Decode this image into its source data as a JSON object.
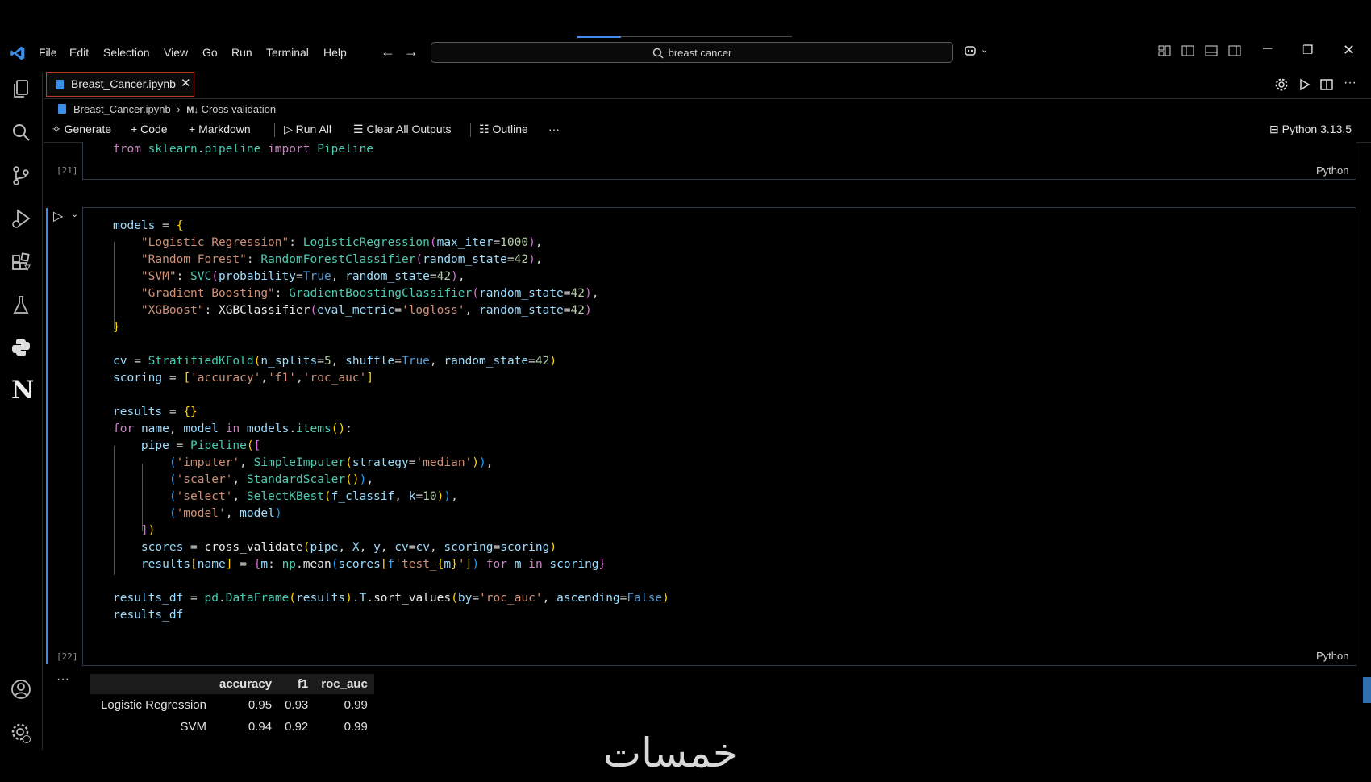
{
  "menu": [
    "File",
    "Edit",
    "Selection",
    "View",
    "Go",
    "Run",
    "Terminal",
    "Help"
  ],
  "search": {
    "text": "breast cancer"
  },
  "tab": {
    "label": "Breast_Cancer.ipynb"
  },
  "breadcrumb": {
    "file": "Breast_Cancer.ipynb",
    "section_prefix": "M↓",
    "section": "Cross validation"
  },
  "toolbar": {
    "generate": "Generate",
    "code": "Code",
    "markdown": "Markdown",
    "run_all": "Run All",
    "clear_outputs": "Clear All Outputs",
    "outline": "Outline",
    "more": "···",
    "kernel": "Python 3.13.5"
  },
  "cell21": {
    "exec_count": "[21]",
    "language": "Python"
  },
  "cell22": {
    "exec_count": "[22]",
    "language": "Python"
  },
  "output": {
    "ellipsis": "···",
    "columns": [
      "accuracy",
      "f1",
      "roc_auc"
    ],
    "rows": [
      {
        "index": "Logistic Regression",
        "accuracy": "0.95",
        "f1": "0.93",
        "roc_auc": "0.99"
      },
      {
        "index": "SVM",
        "accuracy": "0.94",
        "f1": "0.92",
        "roc_auc": "0.99"
      }
    ]
  },
  "watermark": "خمسات",
  "colors": {
    "keyword": "#c586c0",
    "function": "#4ec9b0",
    "string": "#ce9178",
    "variable": "#9cdcfe",
    "number": "#b5cea8",
    "accent": "#3b8eea"
  }
}
